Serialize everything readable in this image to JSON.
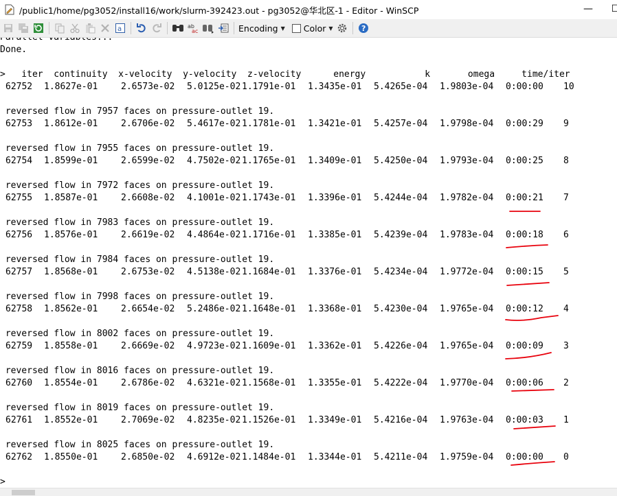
{
  "window": {
    "title": "/public1/home/pg3052/install16/work/slurm-392423.out - pg3052@华北区-1 - Editor - WinSCP",
    "minimize_glyph": "—",
    "maximize_glyph": "☐"
  },
  "toolbar": {
    "encoding_label": "Encoding",
    "color_label": "Color",
    "icons": [
      "save-icon",
      "save-all-icon",
      "reload-icon",
      "copy-icon",
      "cut-icon",
      "paste-icon",
      "delete-icon",
      "select-all-icon",
      "undo-icon",
      "redo-icon",
      "find-icon",
      "replace-icon",
      "find-next-icon",
      "goto-line-icon",
      "settings-icon",
      "help-icon"
    ]
  },
  "editor": {
    "partial_line": "Parallel variables...",
    "done_line": "Done.",
    "blank_line": "",
    "header_line": ">   iter  continuity  x-velocity  y-velocity  z-velocity      energy           k       omega     time/iter",
    "rows": [
      {
        "iter": "62752",
        "continuity": "1.8627e-01",
        "x_velocity": "2.6573e-02",
        "y_velocity": "5.0125e-02",
        "z_velocity": "1.1791e-01",
        "energy": "1.3435e-01",
        "k": "5.4265e-04",
        "omega": "1.9803e-04",
        "time": "0:00:00",
        "remaining": "10",
        "message": ""
      },
      {
        "iter": "62753",
        "continuity": "1.8612e-01",
        "x_velocity": "2.6706e-02",
        "y_velocity": "5.4617e-02",
        "z_velocity": "1.1781e-01",
        "energy": "1.3421e-01",
        "k": "5.4257e-04",
        "omega": "1.9798e-04",
        "time": "0:00:29",
        "remaining": "9",
        "message": " reversed flow in 7957 faces on pressure-outlet 19."
      },
      {
        "iter": "62754",
        "continuity": "1.8599e-01",
        "x_velocity": "2.6599e-02",
        "y_velocity": "4.7502e-02",
        "z_velocity": "1.1765e-01",
        "energy": "1.3409e-01",
        "k": "5.4250e-04",
        "omega": "1.9793e-04",
        "time": "0:00:25",
        "remaining": "8",
        "message": " reversed flow in 7955 faces on pressure-outlet 19."
      },
      {
        "iter": "62755",
        "continuity": "1.8587e-01",
        "x_velocity": "2.6608e-02",
        "y_velocity": "4.1001e-02",
        "z_velocity": "1.1743e-01",
        "energy": "1.3396e-01",
        "k": "5.4244e-04",
        "omega": "1.9782e-04",
        "time": "0:00:21",
        "remaining": "7",
        "message": " reversed flow in 7972 faces on pressure-outlet 19."
      },
      {
        "iter": "62756",
        "continuity": "1.8576e-01",
        "x_velocity": "2.6619e-02",
        "y_velocity": "4.4864e-02",
        "z_velocity": "1.1716e-01",
        "energy": "1.3385e-01",
        "k": "5.4239e-04",
        "omega": "1.9783e-04",
        "time": "0:00:18",
        "remaining": "6",
        "message": " reversed flow in 7983 faces on pressure-outlet 19."
      },
      {
        "iter": "62757",
        "continuity": "1.8568e-01",
        "x_velocity": "2.6753e-02",
        "y_velocity": "4.5138e-02",
        "z_velocity": "1.1684e-01",
        "energy": "1.3376e-01",
        "k": "5.4234e-04",
        "omega": "1.9772e-04",
        "time": "0:00:15",
        "remaining": "5",
        "message": " reversed flow in 7984 faces on pressure-outlet 19."
      },
      {
        "iter": "62758",
        "continuity": "1.8562e-01",
        "x_velocity": "2.6654e-02",
        "y_velocity": "5.2486e-02",
        "z_velocity": "1.1648e-01",
        "energy": "1.3368e-01",
        "k": "5.4230e-04",
        "omega": "1.9765e-04",
        "time": "0:00:12",
        "remaining": "4",
        "message": " reversed flow in 7998 faces on pressure-outlet 19."
      },
      {
        "iter": "62759",
        "continuity": "1.8558e-01",
        "x_velocity": "2.6669e-02",
        "y_velocity": "4.9723e-02",
        "z_velocity": "1.1609e-01",
        "energy": "1.3362e-01",
        "k": "5.4226e-04",
        "omega": "1.9765e-04",
        "time": "0:00:09",
        "remaining": "3",
        "message": " reversed flow in 8002 faces on pressure-outlet 19."
      },
      {
        "iter": "62760",
        "continuity": "1.8554e-01",
        "x_velocity": "2.6786e-02",
        "y_velocity": "4.6321e-02",
        "z_velocity": "1.1568e-01",
        "energy": "1.3355e-01",
        "k": "5.4222e-04",
        "omega": "1.9770e-04",
        "time": "0:00:06",
        "remaining": "2",
        "message": " reversed flow in 8016 faces on pressure-outlet 19."
      },
      {
        "iter": "62761",
        "continuity": "1.8552e-01",
        "x_velocity": "2.7069e-02",
        "y_velocity": "4.8235e-02",
        "z_velocity": "1.1526e-01",
        "energy": "1.3349e-01",
        "k": "5.4216e-04",
        "omega": "1.9763e-04",
        "time": "0:00:03",
        "remaining": "1",
        "message": " reversed flow in 8019 faces on pressure-outlet 19."
      },
      {
        "iter": "62762",
        "continuity": "1.8550e-01",
        "x_velocity": "2.6850e-02",
        "y_velocity": "4.6912e-02",
        "z_velocity": "1.1484e-01",
        "energy": "1.3344e-01",
        "k": "5.4211e-04",
        "omega": "1.9759e-04",
        "time": "0:00:00",
        "remaining": "0",
        "message": " reversed flow in 8025 faces on pressure-outlet 19."
      }
    ],
    "prompt_line": ">",
    "annotation_color": "#e8000b"
  }
}
